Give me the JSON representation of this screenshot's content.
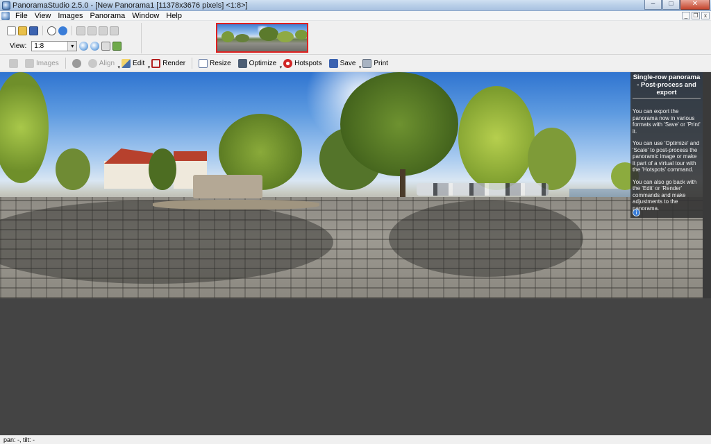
{
  "window": {
    "title": "PanoramaStudio 2.5.0 - [New Panorama1 [11378x3676 pixels] <1:8>]",
    "min_glyph": "–",
    "max_glyph": "□",
    "close_glyph": "✕"
  },
  "menu": {
    "items": [
      "File",
      "View",
      "Images",
      "Panorama",
      "Window",
      "Help"
    ],
    "mdi_min": "_",
    "mdi_restore": "❐",
    "mdi_close": "x"
  },
  "upper_toolbar": {
    "view_label": "View:",
    "zoom_value": "1:8",
    "caret": "▾"
  },
  "toolbar2": {
    "items": [
      {
        "label": "",
        "icon": "workflow-icon",
        "enabled": false
      },
      {
        "label": "Images",
        "icon": "images-icon",
        "enabled": false
      },
      {
        "label": "",
        "icon": "gear-icon",
        "enabled": true
      },
      {
        "label": "Align",
        "icon": "align-icon",
        "enabled": false
      },
      {
        "label": "Edit",
        "icon": "edit-icon",
        "enabled": true
      },
      {
        "label": "Render",
        "icon": "render-icon",
        "enabled": true
      },
      {
        "label": "Resize",
        "icon": "resize-icon",
        "enabled": true
      },
      {
        "label": "Optimize",
        "icon": "optimize-icon",
        "enabled": true
      },
      {
        "label": "Hotspots",
        "icon": "hotspots-icon",
        "enabled": true
      },
      {
        "label": "Save",
        "icon": "save-icon",
        "enabled": true
      },
      {
        "label": "Print",
        "icon": "print-icon",
        "enabled": true
      }
    ],
    "dropdown_arrow": "▾"
  },
  "help_panel": {
    "title": "Single-row panorama - Post-process and export",
    "paragraphs": [
      "You can export the panorama now in various formats with 'Save' or 'Print' it.",
      "You can use 'Optimize' and 'Scale' to post-process the panoramic image or make it part of a virtual tour with the 'Hotspots' command.",
      "You can also go back with the 'Edit' or 'Render' commands and make adjustments to the panorama."
    ],
    "info_glyph": "i"
  },
  "status": {
    "text": "pan: -, tilt: -"
  },
  "colors": {
    "thumbnail_border": "#e02020",
    "viewport_bg": "#444444",
    "help_panel_bg": "#323232"
  }
}
